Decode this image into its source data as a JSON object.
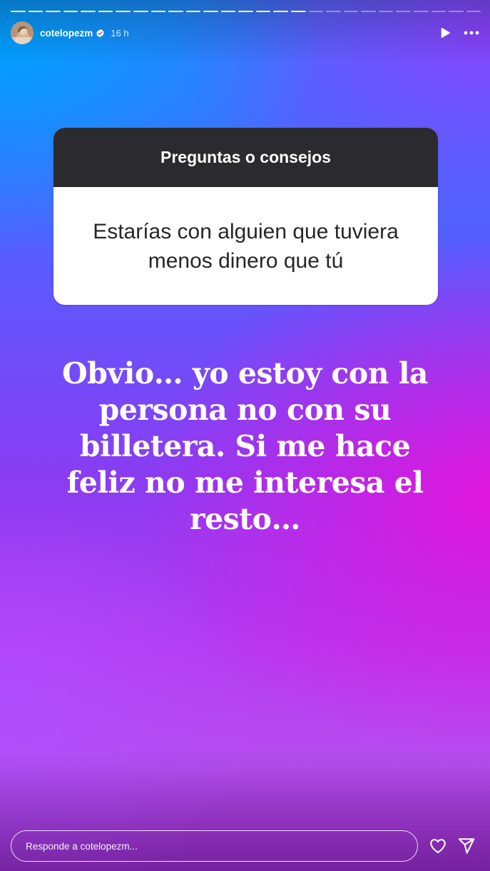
{
  "story": {
    "progress": {
      "total_segments": 27,
      "completed_segments": 17
    },
    "header": {
      "username": "cotelopezm",
      "verified": true,
      "time_ago": "16 h",
      "avatar_icon": "user-avatar",
      "play_icon": "play-icon",
      "more_icon": "more-options-icon"
    },
    "question_sticker": {
      "title": "Preguntas o consejos",
      "question": "Estarías con alguien que tuviera menos dinero que tú"
    },
    "answer": "Obvio… yo estoy con la persona no con su billetera. Si me hace feliz no me interesa el resto…",
    "footer": {
      "reply_placeholder": "Responde a cotelopezm...",
      "like_icon": "heart-icon",
      "share_icon": "send-icon"
    }
  }
}
